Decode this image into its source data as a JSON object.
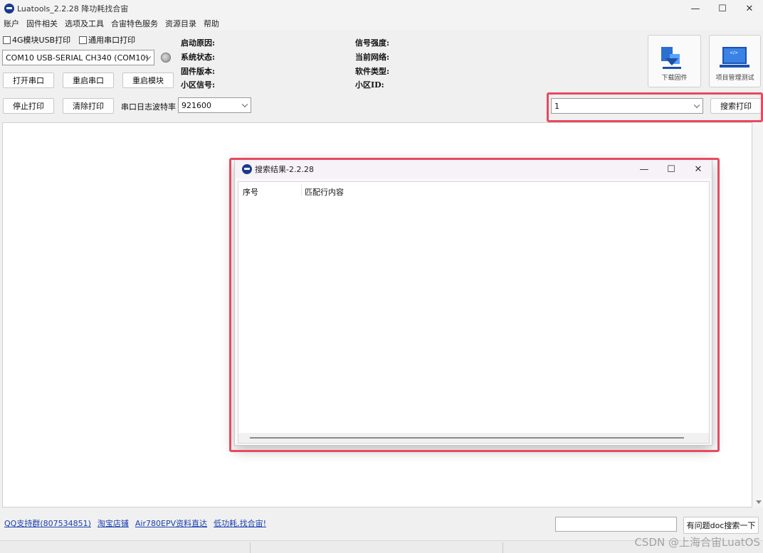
{
  "window": {
    "title": "Luatools_2.2.28 降功耗找合宙",
    "controls": {
      "minimize": "—",
      "maximize": "☐",
      "close": "✕"
    }
  },
  "menu": [
    "账户",
    "固件相关",
    "选项及工具",
    "合宙特色服务",
    "资源目录",
    "帮助"
  ],
  "options": {
    "usb_print_label": "4G模块USB打印",
    "usb_print_checked": false,
    "serial_print_label": "通用串口打印",
    "serial_print_checked": false
  },
  "port": {
    "selected": "COM10 USB-SERIAL CH340 (COM10)"
  },
  "buttons": {
    "open_port": "打开串口",
    "restart_port": "重启串口",
    "restart_module": "重启模块",
    "stop_print": "停止打印",
    "clear_print": "清除打印",
    "search_print": "搜索打印",
    "doc_search": "有问题doc搜索一下"
  },
  "baud": {
    "label": "串口日志波特率",
    "selected": "921600"
  },
  "info": {
    "boot_reason": "启动原因:",
    "system_state": "系统状态:",
    "firmware_version": "固件版本:",
    "cell_signal": "小区信号:",
    "signal_strength": "信号强度:",
    "current_network": "当前网络:",
    "software_type": "软件类型:",
    "cell_id": "小区ID:"
  },
  "tools": {
    "download_firmware": "下载固件",
    "project_test": "项目管理测试",
    "download_icon": "download-icon",
    "laptop_icon": "laptop-icon"
  },
  "search": {
    "value": "1"
  },
  "dialog": {
    "title": "搜索结果-2.2.28",
    "columns": [
      "序号",
      "匹配行内容"
    ],
    "rows": []
  },
  "footer": {
    "links": [
      "QQ支持群(807534851)",
      "淘宝店铺",
      "Air780EPV资料直达",
      "低功耗,找合宙!"
    ],
    "doc_search_value": ""
  },
  "watermark": "CSDN @上海合宙LuatOS",
  "colors": {
    "highlight": "#e8495f",
    "link": "#1a3fb0",
    "logo": "#1a3a8c"
  }
}
